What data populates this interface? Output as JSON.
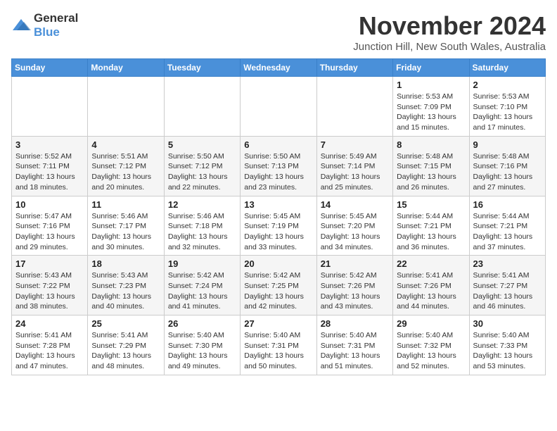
{
  "logo": {
    "text_general": "General",
    "text_blue": "Blue"
  },
  "title": "November 2024",
  "location": "Junction Hill, New South Wales, Australia",
  "weekdays": [
    "Sunday",
    "Monday",
    "Tuesday",
    "Wednesday",
    "Thursday",
    "Friday",
    "Saturday"
  ],
  "weeks": [
    [
      {
        "day": "",
        "info": ""
      },
      {
        "day": "",
        "info": ""
      },
      {
        "day": "",
        "info": ""
      },
      {
        "day": "",
        "info": ""
      },
      {
        "day": "",
        "info": ""
      },
      {
        "day": "1",
        "info": "Sunrise: 5:53 AM\nSunset: 7:09 PM\nDaylight: 13 hours\nand 15 minutes."
      },
      {
        "day": "2",
        "info": "Sunrise: 5:53 AM\nSunset: 7:10 PM\nDaylight: 13 hours\nand 17 minutes."
      }
    ],
    [
      {
        "day": "3",
        "info": "Sunrise: 5:52 AM\nSunset: 7:11 PM\nDaylight: 13 hours\nand 18 minutes."
      },
      {
        "day": "4",
        "info": "Sunrise: 5:51 AM\nSunset: 7:12 PM\nDaylight: 13 hours\nand 20 minutes."
      },
      {
        "day": "5",
        "info": "Sunrise: 5:50 AM\nSunset: 7:12 PM\nDaylight: 13 hours\nand 22 minutes."
      },
      {
        "day": "6",
        "info": "Sunrise: 5:50 AM\nSunset: 7:13 PM\nDaylight: 13 hours\nand 23 minutes."
      },
      {
        "day": "7",
        "info": "Sunrise: 5:49 AM\nSunset: 7:14 PM\nDaylight: 13 hours\nand 25 minutes."
      },
      {
        "day": "8",
        "info": "Sunrise: 5:48 AM\nSunset: 7:15 PM\nDaylight: 13 hours\nand 26 minutes."
      },
      {
        "day": "9",
        "info": "Sunrise: 5:48 AM\nSunset: 7:16 PM\nDaylight: 13 hours\nand 27 minutes."
      }
    ],
    [
      {
        "day": "10",
        "info": "Sunrise: 5:47 AM\nSunset: 7:16 PM\nDaylight: 13 hours\nand 29 minutes."
      },
      {
        "day": "11",
        "info": "Sunrise: 5:46 AM\nSunset: 7:17 PM\nDaylight: 13 hours\nand 30 minutes."
      },
      {
        "day": "12",
        "info": "Sunrise: 5:46 AM\nSunset: 7:18 PM\nDaylight: 13 hours\nand 32 minutes."
      },
      {
        "day": "13",
        "info": "Sunrise: 5:45 AM\nSunset: 7:19 PM\nDaylight: 13 hours\nand 33 minutes."
      },
      {
        "day": "14",
        "info": "Sunrise: 5:45 AM\nSunset: 7:20 PM\nDaylight: 13 hours\nand 34 minutes."
      },
      {
        "day": "15",
        "info": "Sunrise: 5:44 AM\nSunset: 7:21 PM\nDaylight: 13 hours\nand 36 minutes."
      },
      {
        "day": "16",
        "info": "Sunrise: 5:44 AM\nSunset: 7:21 PM\nDaylight: 13 hours\nand 37 minutes."
      }
    ],
    [
      {
        "day": "17",
        "info": "Sunrise: 5:43 AM\nSunset: 7:22 PM\nDaylight: 13 hours\nand 38 minutes."
      },
      {
        "day": "18",
        "info": "Sunrise: 5:43 AM\nSunset: 7:23 PM\nDaylight: 13 hours\nand 40 minutes."
      },
      {
        "day": "19",
        "info": "Sunrise: 5:42 AM\nSunset: 7:24 PM\nDaylight: 13 hours\nand 41 minutes."
      },
      {
        "day": "20",
        "info": "Sunrise: 5:42 AM\nSunset: 7:25 PM\nDaylight: 13 hours\nand 42 minutes."
      },
      {
        "day": "21",
        "info": "Sunrise: 5:42 AM\nSunset: 7:26 PM\nDaylight: 13 hours\nand 43 minutes."
      },
      {
        "day": "22",
        "info": "Sunrise: 5:41 AM\nSunset: 7:26 PM\nDaylight: 13 hours\nand 44 minutes."
      },
      {
        "day": "23",
        "info": "Sunrise: 5:41 AM\nSunset: 7:27 PM\nDaylight: 13 hours\nand 46 minutes."
      }
    ],
    [
      {
        "day": "24",
        "info": "Sunrise: 5:41 AM\nSunset: 7:28 PM\nDaylight: 13 hours\nand 47 minutes."
      },
      {
        "day": "25",
        "info": "Sunrise: 5:41 AM\nSunset: 7:29 PM\nDaylight: 13 hours\nand 48 minutes."
      },
      {
        "day": "26",
        "info": "Sunrise: 5:40 AM\nSunset: 7:30 PM\nDaylight: 13 hours\nand 49 minutes."
      },
      {
        "day": "27",
        "info": "Sunrise: 5:40 AM\nSunset: 7:31 PM\nDaylight: 13 hours\nand 50 minutes."
      },
      {
        "day": "28",
        "info": "Sunrise: 5:40 AM\nSunset: 7:31 PM\nDaylight: 13 hours\nand 51 minutes."
      },
      {
        "day": "29",
        "info": "Sunrise: 5:40 AM\nSunset: 7:32 PM\nDaylight: 13 hours\nand 52 minutes."
      },
      {
        "day": "30",
        "info": "Sunrise: 5:40 AM\nSunset: 7:33 PM\nDaylight: 13 hours\nand 53 minutes."
      }
    ]
  ]
}
